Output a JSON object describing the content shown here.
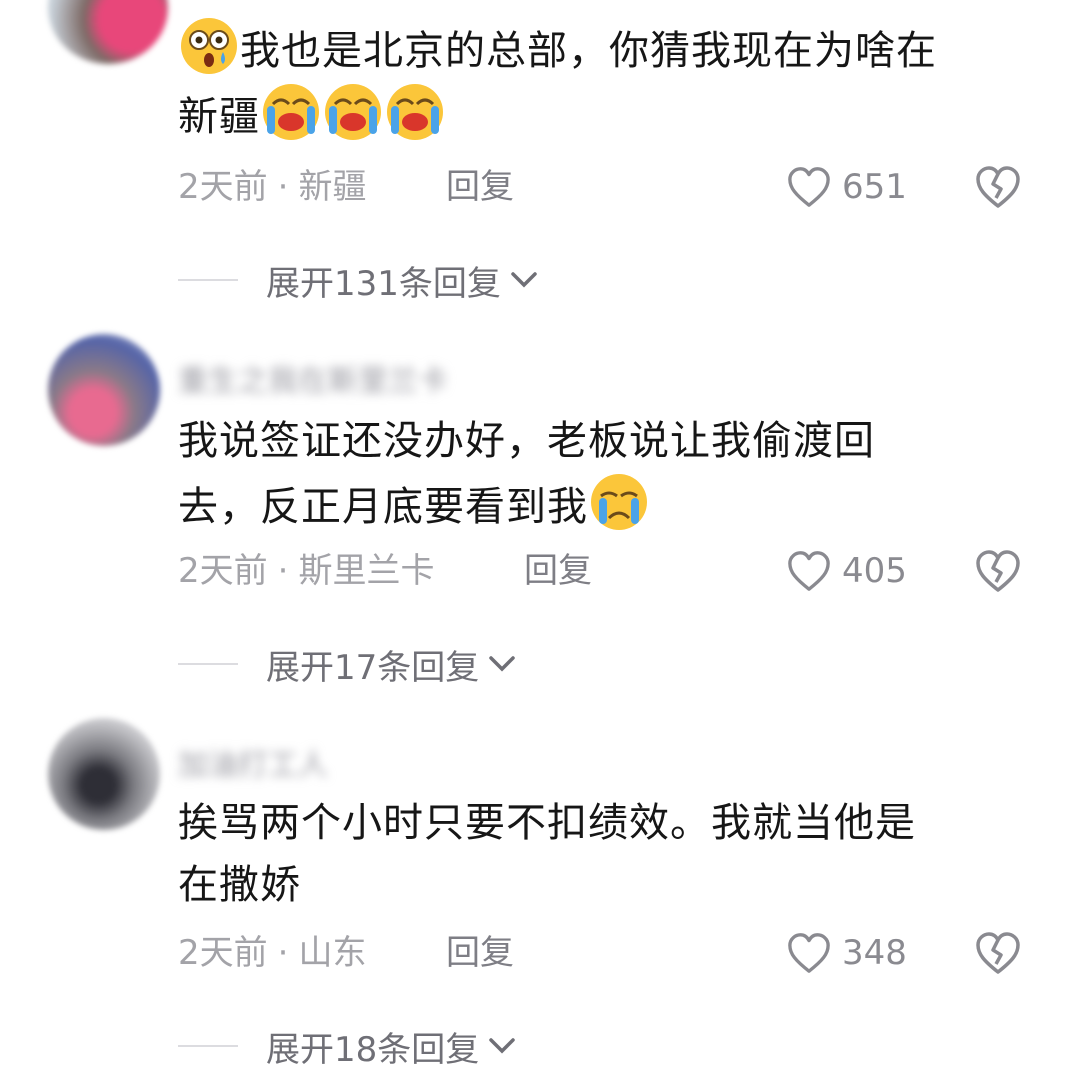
{
  "colors": {
    "meta_text": "#a3a3a8",
    "expand_text": "#6f6f76",
    "emoji_yellow": "#fbc63a",
    "emoji_tear": "#4aa3e8"
  },
  "comments": [
    {
      "text_line1": "我也是北京的总部，你猜我现在为啥在",
      "text_line2": "新疆",
      "emoji_lead": "astonished-face-icon",
      "emoji_trail": [
        "loudly-crying-face-icon",
        "loudly-crying-face-icon",
        "loudly-crying-face-icon"
      ],
      "time": "2天前",
      "location": "新疆",
      "reply_label": "回复",
      "likes": "651",
      "expand_label": "展开131条回复"
    },
    {
      "username": "重生之我在斯里兰卡",
      "text_line1": "我说签证还没办好，老板说让我偷渡回",
      "text_line2": "去，反正月底要看到我",
      "emoji_trail": [
        "loudly-crying-face-icon"
      ],
      "time": "2天前",
      "location": "斯里兰卡",
      "reply_label": "回复",
      "likes": "405",
      "expand_label": "展开17条回复"
    },
    {
      "username": "加油打工人",
      "text_line1": "挨骂两个小时只要不扣绩效。我就当他是",
      "text_line2": "在撒娇",
      "time": "2天前",
      "location": "山东",
      "reply_label": "回复",
      "likes": "348",
      "expand_label": "展开18条回复"
    }
  ],
  "separator": "·"
}
